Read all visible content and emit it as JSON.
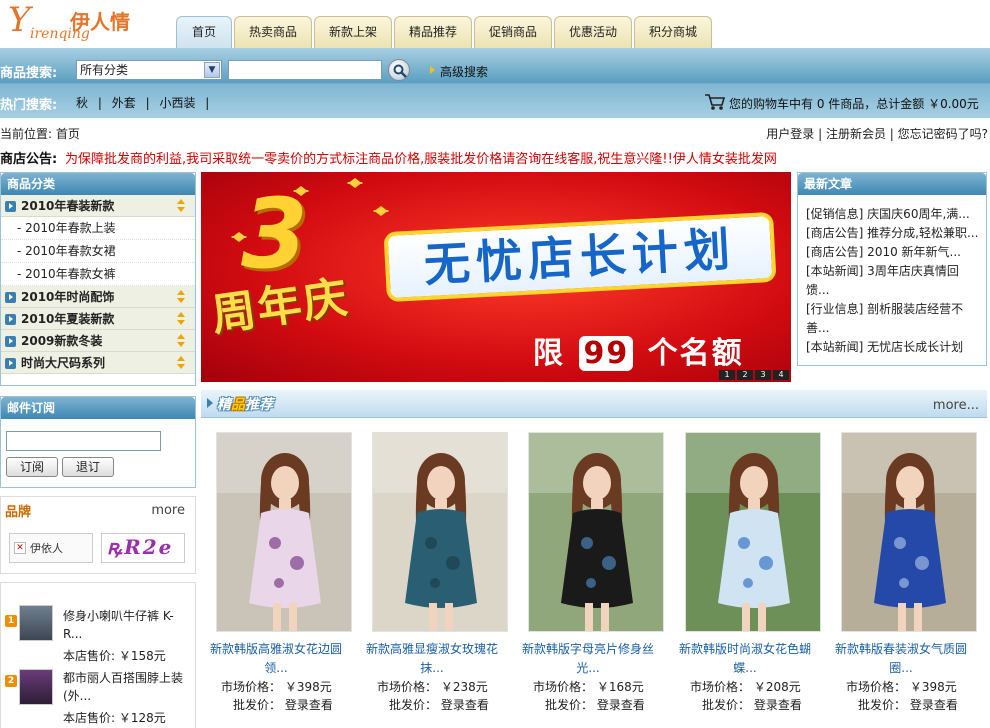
{
  "logo": {
    "script": "Y",
    "cn": "伊人情",
    "sub": "irenqing"
  },
  "nav": [
    {
      "label": "首页",
      "active": true
    },
    {
      "label": "热卖商品"
    },
    {
      "label": "新款上架"
    },
    {
      "label": "精品推荐"
    },
    {
      "label": "促销商品"
    },
    {
      "label": "优惠活动"
    },
    {
      "label": "积分商城"
    }
  ],
  "search": {
    "label": "商品搜索:",
    "category": "所有分类",
    "advanced": "高级搜索"
  },
  "hot": {
    "label": "热门搜索:",
    "links": [
      "秋",
      "|",
      "外套",
      "|",
      "小西装",
      "|"
    ]
  },
  "cart": {
    "text": "您的购物车中有  0 件商品，总计金额 ￥0.00元"
  },
  "crumb": {
    "text": "当前位置: 首页"
  },
  "user_links": {
    "text": "用户登录 | 注册新会员 | 您忘记密码了吗?"
  },
  "notice": {
    "label": "商店公告:",
    "text": "为保障批发商的利益,我司采取统一零卖价的方式标注商品价格,服装批发价格请咨询在线客服,祝生意兴隆!!伊人情女装批发网"
  },
  "category": {
    "title": "商品分类",
    "groups": [
      {
        "label": "2010年春装新款",
        "subs": [
          "- 2010年春款上装",
          "- 2010年春款女裙",
          "- 2010年春款女裤"
        ]
      },
      {
        "label": "2010年时尚配饰"
      },
      {
        "label": "2010年夏装新款"
      },
      {
        "label": "2009新款冬装"
      },
      {
        "label": "时尚大尺码系列"
      }
    ]
  },
  "mail": {
    "title": "邮件订阅",
    "subscribe": "订阅",
    "unsubscribe": "退订"
  },
  "brand": {
    "title": "品牌",
    "more": "more",
    "logo1": "伊依人"
  },
  "side_products": [
    {
      "badge": "1",
      "name": "修身小喇叭牛仔裤 K-R...",
      "price": "本店售价: ￥158元"
    },
    {
      "badge": "2",
      "name": "都市丽人百搭围脖上装(外...",
      "price": "本店售价: ￥128元"
    }
  ],
  "banner": {
    "big3": "3",
    "anniv": "周年庆",
    "main": "无忧店长计划",
    "limit_pre": "限",
    "limit_num": "99",
    "limit_post": "个名额",
    "dots": [
      "1",
      "2",
      "3",
      "4"
    ]
  },
  "news": {
    "title": "最新文章",
    "items": [
      "[促销信息] 庆国庆60周年,满...",
      "[商店公告] 推荐分成,轻松兼职...",
      "[商店公告] 2010 新年新气...",
      "[本站新闻] 3周年店庆真情回馈...",
      "[行业信息] 剖析服装店经营不善...",
      "[本站新闻] 无忧店长成长计划"
    ]
  },
  "featured": {
    "title_a": "精",
    "title_b": "品",
    "title_c": "推荐",
    "more": "more...",
    "products": [
      {
        "name": "新款韩版高雅淑女花边圆领...",
        "market": "市场价格： ￥398元",
        "wholesale": "批发价： 登录查看",
        "dress": "#e9d6e8",
        "accent": "#7d3f8c",
        "bg": "#c9c3b8"
      },
      {
        "name": "新款高雅显瘦淑女玫瑰花抹...",
        "market": "市场价格： ￥238元",
        "wholesale": "批发价： 登录查看",
        "dress": "#2a5f73",
        "accent": "#1b3f4d",
        "bg": "#dcd6c9"
      },
      {
        "name": "新款韩版字母亮片修身丝光...",
        "market": "市场价格： ￥168元",
        "wholesale": "批发价： 登录查看",
        "dress": "#1a1a1a",
        "accent": "#4d7fb5",
        "bg": "#8fa77a"
      },
      {
        "name": "新款韩版时尚淑女花色蝴蝶...",
        "market": "市场价格： ￥208元",
        "wholesale": "批发价： 登录查看",
        "dress": "#cfe3f3",
        "accent": "#3a78c4",
        "bg": "#6d8f58"
      },
      {
        "name": "新款韩版春装淑女气质圆圈...",
        "market": "市场价格： ￥398元",
        "wholesale": "批发价： 登录查看",
        "dress": "#2549a8",
        "accent": "#9fb7e4",
        "bg": "#b7ae9a"
      }
    ]
  }
}
